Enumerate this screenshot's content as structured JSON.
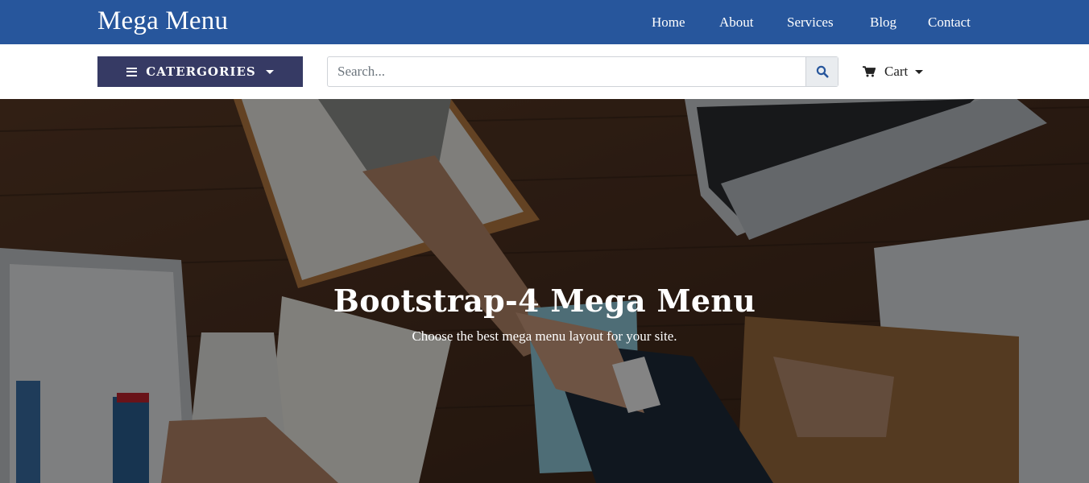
{
  "brand": "Mega Menu",
  "nav": [
    {
      "label": "Home"
    },
    {
      "label": "About"
    },
    {
      "label": "Services"
    },
    {
      "label": "Blog"
    },
    {
      "label": "Contact"
    }
  ],
  "categories_button": "CATERGORIES",
  "search": {
    "placeholder": "Search...",
    "value": ""
  },
  "cart_label": "Cart",
  "hero": {
    "title": "Bootstrap-4 Mega Menu",
    "subtitle": "Choose the best mega menu layout for your site."
  },
  "colors": {
    "navbar": "#27569c",
    "categories_button": "#363a64",
    "search_button_bg": "#e9ecef",
    "search_icon": "#27569c"
  },
  "icons": {
    "categories": "bars-icon",
    "search": "search-icon",
    "cart": "cart-icon"
  }
}
